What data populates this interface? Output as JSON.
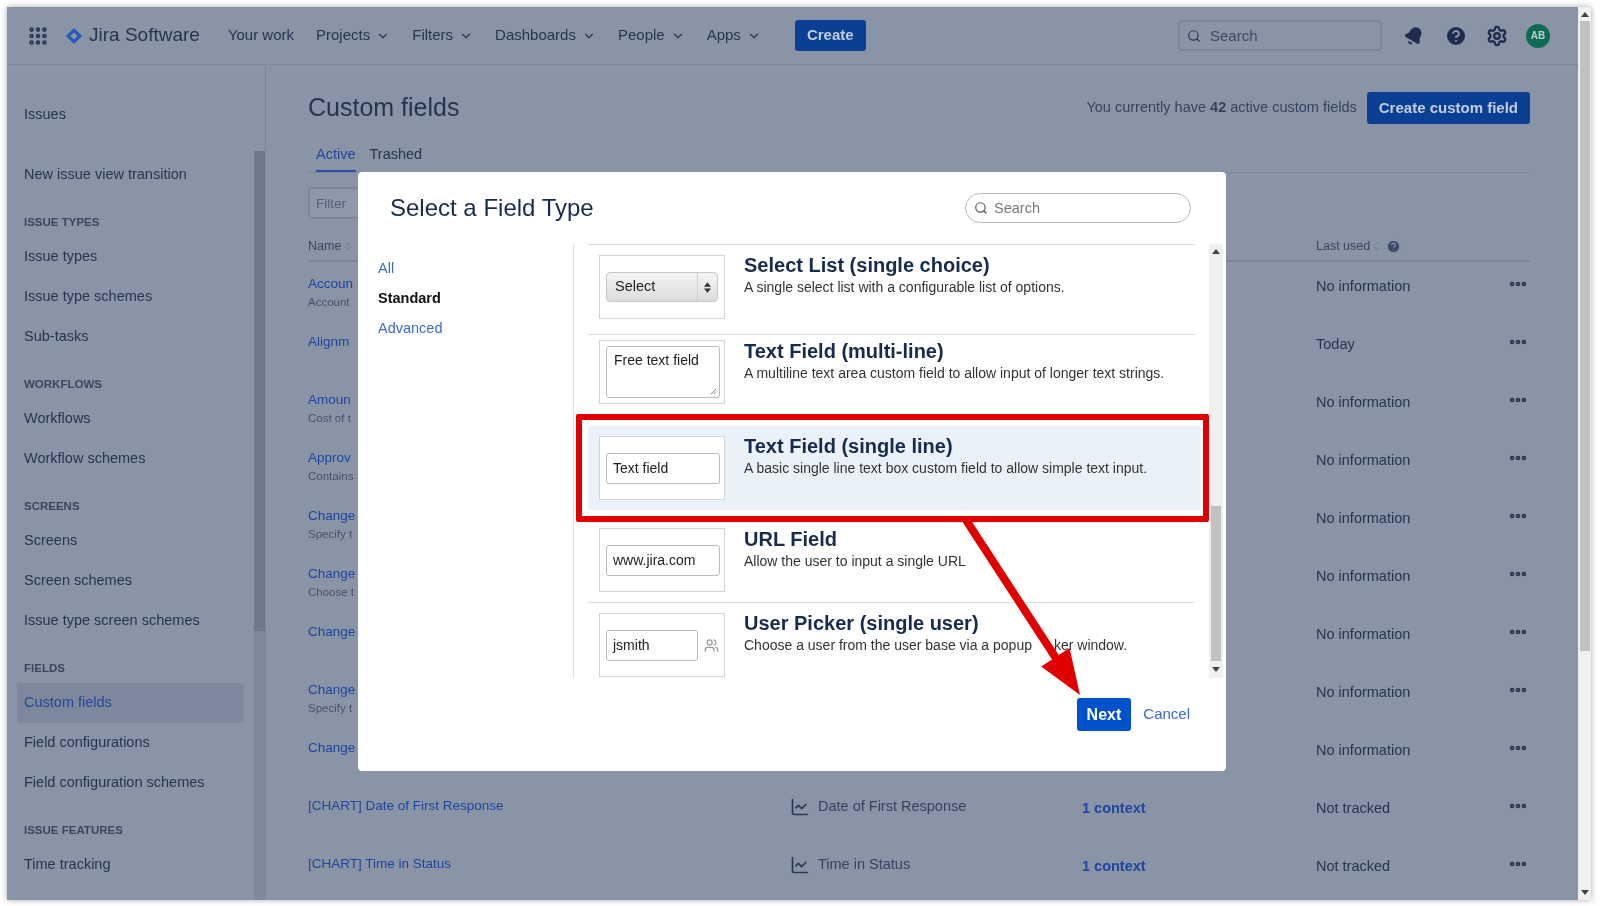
{
  "nav": {
    "product": "Jira Software",
    "items": [
      {
        "label": "Your work",
        "dropdown": false
      },
      {
        "label": "Projects",
        "dropdown": true
      },
      {
        "label": "Filters",
        "dropdown": true
      },
      {
        "label": "Dashboards",
        "dropdown": true
      },
      {
        "label": "People",
        "dropdown": true
      },
      {
        "label": "Apps",
        "dropdown": true
      }
    ],
    "create": "Create",
    "search": {
      "placeholder": "Search"
    },
    "avatar": "AB"
  },
  "sidebar": {
    "items": [
      {
        "kind": "item",
        "label": "Issues",
        "selected": false
      },
      {
        "kind": "item",
        "label": "New issue view transition",
        "selected": false
      },
      {
        "kind": "heading",
        "label": "ISSUE TYPES"
      },
      {
        "kind": "item",
        "label": "Issue types",
        "selected": false
      },
      {
        "kind": "item",
        "label": "Issue type schemes",
        "selected": false
      },
      {
        "kind": "item",
        "label": "Sub-tasks",
        "selected": false
      },
      {
        "kind": "heading",
        "label": "WORKFLOWS"
      },
      {
        "kind": "item",
        "label": "Workflows",
        "selected": false
      },
      {
        "kind": "item",
        "label": "Workflow schemes",
        "selected": false
      },
      {
        "kind": "heading",
        "label": "SCREENS"
      },
      {
        "kind": "item",
        "label": "Screens",
        "selected": false
      },
      {
        "kind": "item",
        "label": "Screen schemes",
        "selected": false
      },
      {
        "kind": "item",
        "label": "Issue type screen schemes",
        "selected": false
      },
      {
        "kind": "heading",
        "label": "FIELDS"
      },
      {
        "kind": "item",
        "label": "Custom fields",
        "selected": true
      },
      {
        "kind": "item",
        "label": "Field configurations",
        "selected": false
      },
      {
        "kind": "item",
        "label": "Field configuration schemes",
        "selected": false
      },
      {
        "kind": "heading",
        "label": "ISSUE FEATURES"
      },
      {
        "kind": "item",
        "label": "Time tracking",
        "selected": false
      }
    ]
  },
  "page": {
    "title": "Custom fields",
    "summary": "You currently have **42** active custom fields",
    "create_button": "Create custom field",
    "tabs": [
      {
        "label": "Active",
        "selected": true
      },
      {
        "label": "Trashed",
        "selected": false
      }
    ],
    "filter": {
      "placeholder": "Filter"
    }
  },
  "table": {
    "columns": [
      {
        "kind": "name",
        "label": "Name"
      },
      {
        "kind": "last_used",
        "label": "Last used"
      }
    ],
    "rows": [
      {
        "name": "Accoun",
        "description": "Account",
        "last_used": "No information"
      },
      {
        "name": "Alignm",
        "last_used": "Today"
      },
      {
        "name": "Amoun",
        "description": "Cost of t",
        "last_used": "No information"
      },
      {
        "name": "Approv",
        "description": "Contains",
        "last_used": "No information"
      },
      {
        "name": "Change",
        "description": "Specify t",
        "last_used": "No information"
      },
      {
        "name": "Change",
        "description": "Choose t",
        "last_used": "No information"
      },
      {
        "name": "Change",
        "last_used": "No information"
      },
      {
        "name": "Change",
        "description": "Specify t",
        "last_used": "No information"
      },
      {
        "name": "Change",
        "last_used": "No information"
      },
      {
        "name": "[CHART] Date of First Response",
        "type": "Date of First Response",
        "contexts": "1 context",
        "last_used": "Not tracked"
      },
      {
        "name": "[CHART] Time in Status",
        "type": "Time in Status",
        "contexts": "1 context",
        "last_used": "Not tracked"
      }
    ]
  },
  "dialog": {
    "title": "Select a Field Type",
    "search": {
      "placeholder": "Search"
    },
    "categories": [
      {
        "label": "All",
        "selected": false
      },
      {
        "label": "Standard",
        "selected": true
      },
      {
        "label": "Advanced",
        "selected": false
      }
    ],
    "field_types": [
      {
        "kind": "select",
        "preview": "Select",
        "title": "Select List (single choice)",
        "description": "A single select list with a configurable list of options.",
        "selected": false
      },
      {
        "kind": "textarea",
        "preview": "Free text field",
        "title": "Text Field (multi-line)",
        "description": "A multiline text area custom field to allow input of longer text strings.",
        "selected": false
      },
      {
        "kind": "text",
        "preview": "Text field",
        "title": "Text Field (single line)",
        "description": "A basic single line text box custom field to allow simple text input.",
        "selected": true
      },
      {
        "kind": "text",
        "preview": "www.jira.com",
        "title": "URL Field",
        "description": "Allow the user to input a single URL",
        "selected": false
      },
      {
        "kind": "user",
        "preview": "jsmith",
        "title": "User Picker (single user)",
        "description": "Choose a user from the user base via a popup",
        "description_end": "ker window.",
        "selected": false
      }
    ],
    "next": "Next",
    "cancel": "Cancel"
  }
}
